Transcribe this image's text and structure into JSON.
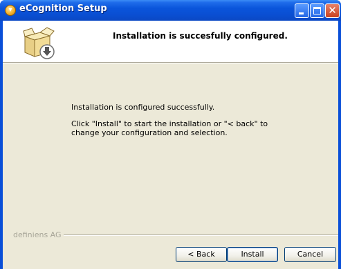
{
  "window": {
    "title": "eCognition Setup",
    "header_title": "Installation is succesfully configured."
  },
  "body": {
    "line1": "Installation is configured successfully.",
    "line2": "Click \"Install\" to start the installation or \"< back\" to",
    "line3": "change your configuration and selection."
  },
  "footer": {
    "brand": "definiens AG"
  },
  "buttons": {
    "back": "< Back",
    "install": "Install",
    "cancel": "Cancel"
  },
  "icons": {
    "app": "setup-app-icon",
    "header": "box-install-icon",
    "minimize": "minimize-icon",
    "maximize": "maximize-icon",
    "close": "close-icon"
  },
  "colors": {
    "titlebar": "#0a4fd8",
    "dialog_bg": "#ece9d8",
    "header_bg": "#ffffff"
  }
}
